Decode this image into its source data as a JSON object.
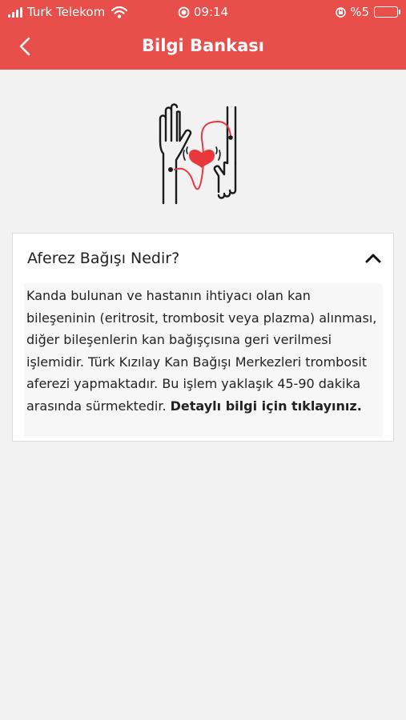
{
  "status_bar": {
    "carrier": "Turk Telekom",
    "time": "09:14",
    "battery": "%5",
    "icons": [
      "signal-icon",
      "wifi-icon",
      "alarm-icon",
      "orientation-lock-icon",
      "battery-icon"
    ]
  },
  "nav": {
    "title": "Bilgi Bankası",
    "back_icon": "chevron-left-icon"
  },
  "colors": {
    "brand": "#e84e4a",
    "background": "#f2f2f2",
    "heart": "#e8383d"
  },
  "illustration": {
    "icon": "blood-donation-hands-heart-icon"
  },
  "faq": {
    "expanded": true,
    "question": "Aferez Bağışı Nedir?",
    "answer": "Kanda bulunan ve hastanın ihtiyacı olan kan bileşeninin (eritrosit, trombosit veya plazma) alınması, diğer bileşenlerin kan bağışçısına geri verilmesi işlemidir. Türk Kızılay Kan Bağışı Merkezleri trombosit aferezi yapmaktadır. Bu işlem yaklaşık 45-90 dakika arasında sürmektedir.",
    "more_link": "Detaylı bilgi için tıklayınız."
  }
}
